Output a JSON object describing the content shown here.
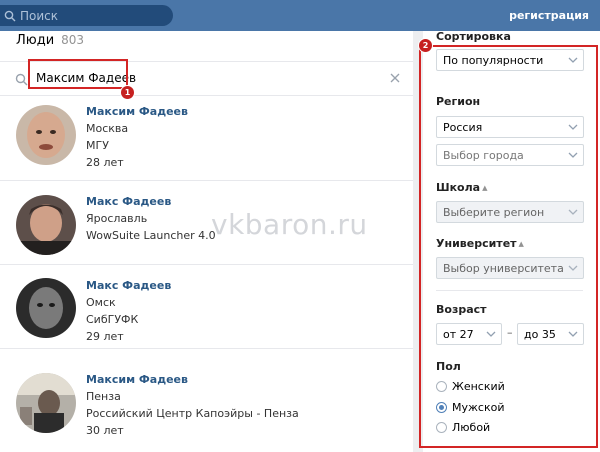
{
  "topbar": {
    "search_placeholder": "Поиск",
    "register_label": "регистрация"
  },
  "people": {
    "title": "Люди",
    "count": "803"
  },
  "search": {
    "value": "Максим Фадеев"
  },
  "annotations": {
    "badge1": "1",
    "badge2": "2"
  },
  "watermark": "vkbaron.ru",
  "results": [
    {
      "name": "Максим Фадеев",
      "lines": [
        "Москва",
        "МГУ",
        "28 лет"
      ]
    },
    {
      "name": "Макс Фадеев",
      "lines": [
        "Ярославль",
        "WowSuite Launcher 4.0"
      ]
    },
    {
      "name": "Макс Фадеев",
      "lines": [
        "Омск",
        "СибГУФК",
        "29 лет"
      ]
    },
    {
      "name": "Максим Фадеев",
      "lines": [
        "Пенза",
        "Российский Центр Капоэйры - Пенза",
        "30 лет"
      ]
    }
  ],
  "filters": {
    "sort_title": "Сортировка",
    "sort_value": "По популярности",
    "region_title": "Регион",
    "country_value": "Россия",
    "city_placeholder": "Выбор города",
    "school_title": "Школа",
    "school_placeholder": "Выберите регион",
    "university_title": "Университет",
    "university_placeholder": "Выбор университета",
    "age_title": "Возраст",
    "age_from": "от 27",
    "age_to": "до 35",
    "gender_title": "Пол",
    "gender_options": [
      {
        "label": "Женский",
        "checked": false
      },
      {
        "label": "Мужской",
        "checked": true
      },
      {
        "label": "Любой",
        "checked": false
      }
    ]
  },
  "colors": {
    "header": "#4a76a8",
    "link": "#2a5885",
    "highlight": "#d32525"
  },
  "icons": [
    "search-icon",
    "close-icon",
    "chevron-down-icon",
    "arrow-up-icon"
  ]
}
